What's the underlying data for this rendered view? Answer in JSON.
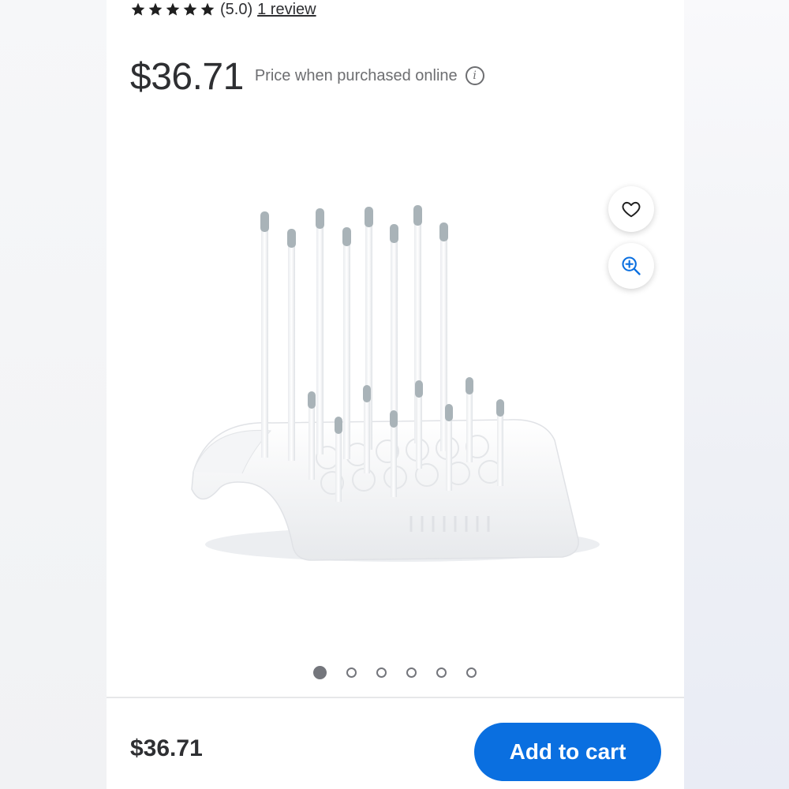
{
  "rating": {
    "stars": 5,
    "value_text": "(5.0)",
    "review_link": "1 review"
  },
  "price": {
    "amount": "$36.71",
    "note": "Price when purchased online",
    "info_icon": "i"
  },
  "gallery": {
    "image_alt": "Bottle drying rack",
    "total_images": 6,
    "active_index": 0,
    "actions": [
      "heart-icon",
      "zoom-in-icon"
    ]
  },
  "footer": {
    "price": "$36.71",
    "add_to_cart_label": "Add to cart"
  },
  "colors": {
    "accent": "#0a6fe0",
    "text": "#2e2f32",
    "muted": "#6d6e71"
  }
}
